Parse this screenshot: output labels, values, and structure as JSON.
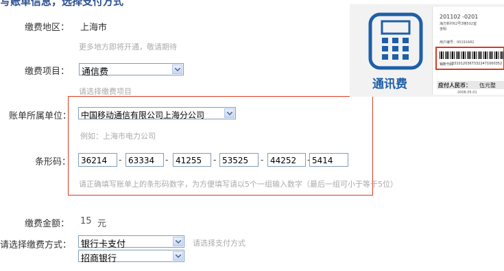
{
  "header": {
    "title": "写账单信息，选择支付方式"
  },
  "region": {
    "label": "缴费地区：",
    "value": "上海市",
    "hint": "更多地方即将开通，敬请期待"
  },
  "item": {
    "label": "缴费项目：",
    "selected": "通信费",
    "hint": "请选择缴费项目"
  },
  "unit": {
    "label": "账单所属单位：",
    "selected": "中国移动通信有限公司上海分公司",
    "hint": "例如：上海市电力公司"
  },
  "barcode": {
    "label": "条形码：",
    "segments": [
      "36214",
      "63334",
      "41255",
      "53525",
      "44252",
      "5414"
    ],
    "separator": "-",
    "hint": "请正确填写账单上的条形码数字，为方便填写请以5个一组输入数字（最后一组可小于等于5位）"
  },
  "amount": {
    "label": "缴费金额：",
    "value": "15",
    "unit": "元"
  },
  "payment": {
    "label": "请选择缴费方式：",
    "method": "银行卡支付",
    "hint": "请选择支付方式",
    "bank": "招商银行"
  },
  "sample_bill": {
    "caption": "通讯费",
    "code_top": "201102 -0201",
    "addr": "海方新村62号3幢502室",
    "name": "李明",
    "account": "用户编号：00191682",
    "barcode_no": "03101203673322471000352",
    "barcode_label": "销账代码",
    "pay_label": "应付人民币：",
    "pay_value": "伍元整",
    "date": "2008.05.01",
    "colors": {
      "icon": "#1e5fa8",
      "red": "#d9381e"
    }
  }
}
